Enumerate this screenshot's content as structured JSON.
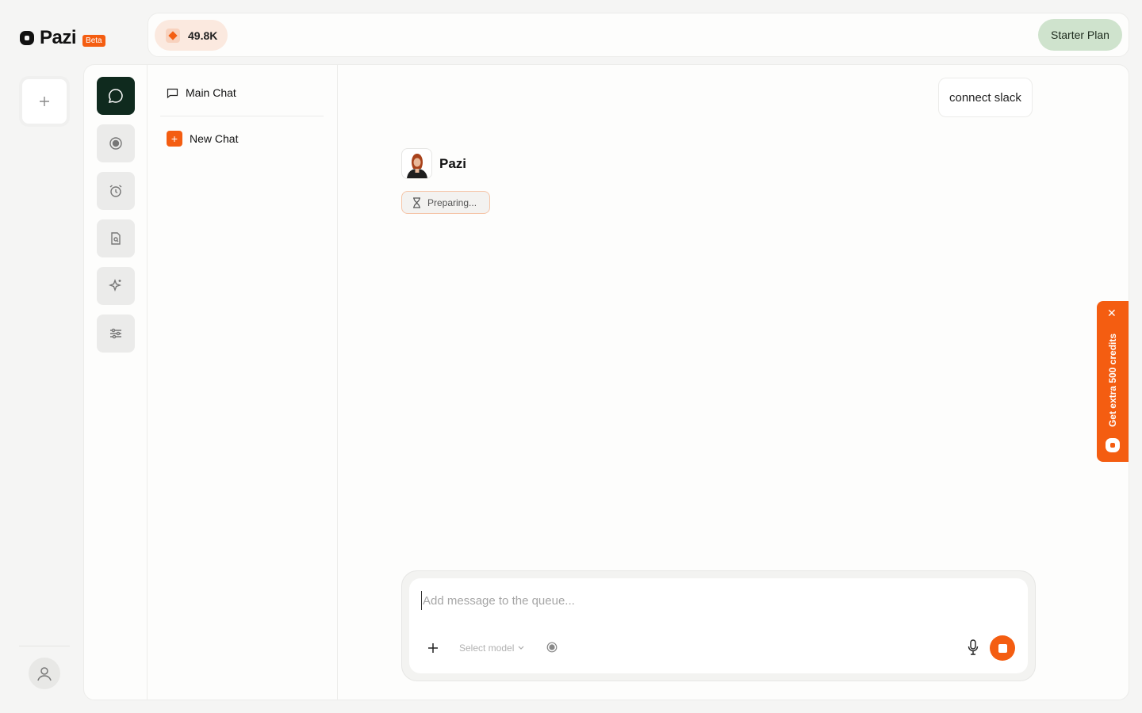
{
  "brand": {
    "name": "Pazi",
    "badge": "Beta"
  },
  "topbar": {
    "credits": "49.8K",
    "plan_label": "Starter Plan"
  },
  "chat_list": {
    "main_chat": "Main Chat",
    "new_chat": "New Chat"
  },
  "conversation": {
    "user_message": "connect slack",
    "agent_name": "Pazi",
    "status": "Preparing..."
  },
  "composer": {
    "placeholder": "Add message to the queue...",
    "model_select": "Select model"
  },
  "promo": {
    "text": "Get extra 500 credits"
  },
  "nav_icons": [
    "chat-icon",
    "target-icon",
    "alarm-clock-icon",
    "document-search-icon",
    "sparkles-icon",
    "sliders-icon"
  ],
  "colors": {
    "accent": "#f45d11",
    "active_nav": "#0f2a1e",
    "plan_bg": "#cfe3cd",
    "credits_bg": "#fbe9df"
  }
}
